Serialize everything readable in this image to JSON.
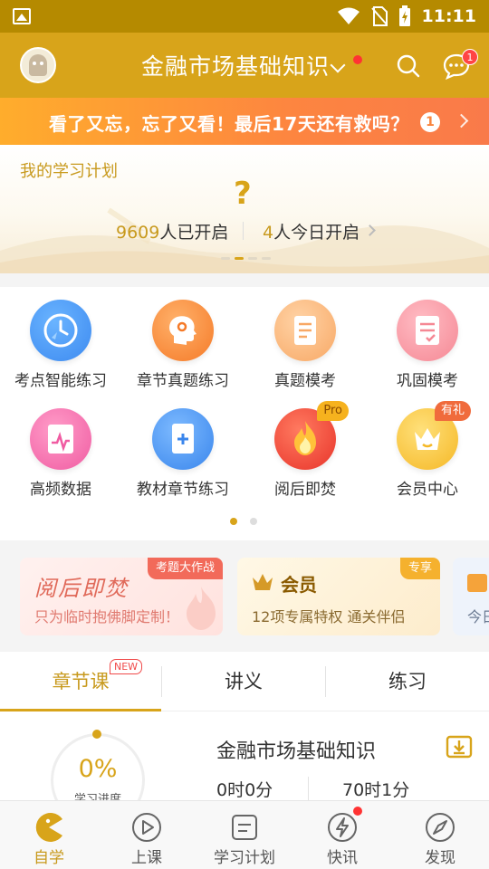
{
  "status_bar": {
    "time": "11:11"
  },
  "header": {
    "title": "金融市场基础知识",
    "message_count": "1"
  },
  "promo": {
    "text": "看了又忘，忘了又看！最后17天还有救吗？",
    "page_num": "1"
  },
  "study_plan": {
    "title": "我的学习计划",
    "placeholder_symbol": "?",
    "started_count": "9609",
    "started_label": "人已开启",
    "today_count": "4",
    "today_label": "人今日开启"
  },
  "features": [
    {
      "label": "考点智能练习",
      "icon": "clock-icon"
    },
    {
      "label": "章节真题练习",
      "icon": "head-gear-icon"
    },
    {
      "label": "真题模考",
      "icon": "document-icon"
    },
    {
      "label": "巩固模考",
      "icon": "checklist-icon"
    },
    {
      "label": "高频数据",
      "icon": "chart-card-icon"
    },
    {
      "label": "教材章节练习",
      "icon": "book-plus-icon"
    },
    {
      "label": "阅后即焚",
      "icon": "flame-icon",
      "ribbon": "Pro"
    },
    {
      "label": "会员中心",
      "icon": "crown-icon",
      "ribbon": "有礼"
    }
  ],
  "cards": [
    {
      "title": "阅后即焚",
      "tag": "考题大作战",
      "subtitle": "只为临时抱佛脚定制！"
    },
    {
      "title": "会员",
      "tag": "专享",
      "subtitle": "12项专属特权  通关伴侣"
    },
    {
      "subtitle": "今日"
    }
  ],
  "tabs": [
    {
      "label": "章节课",
      "badge": "NEW"
    },
    {
      "label": "讲义"
    },
    {
      "label": "练习"
    }
  ],
  "course": {
    "progress_value": "0%",
    "progress_label": "学习进度",
    "name": "金融市场基础知识",
    "time_spent": "0时0分",
    "time_total": "70时1分"
  },
  "bottom_nav": [
    {
      "label": "自学",
      "icon": "pacman-icon"
    },
    {
      "label": "上课",
      "icon": "play-icon"
    },
    {
      "label": "学习计划",
      "icon": "plan-icon"
    },
    {
      "label": "快讯",
      "icon": "lightning-icon"
    },
    {
      "label": "发现",
      "icon": "compass-icon"
    }
  ],
  "colors": {
    "brand": "#d8a41a",
    "accent_red": "#f33333",
    "promo_orange": "#fd8540"
  }
}
